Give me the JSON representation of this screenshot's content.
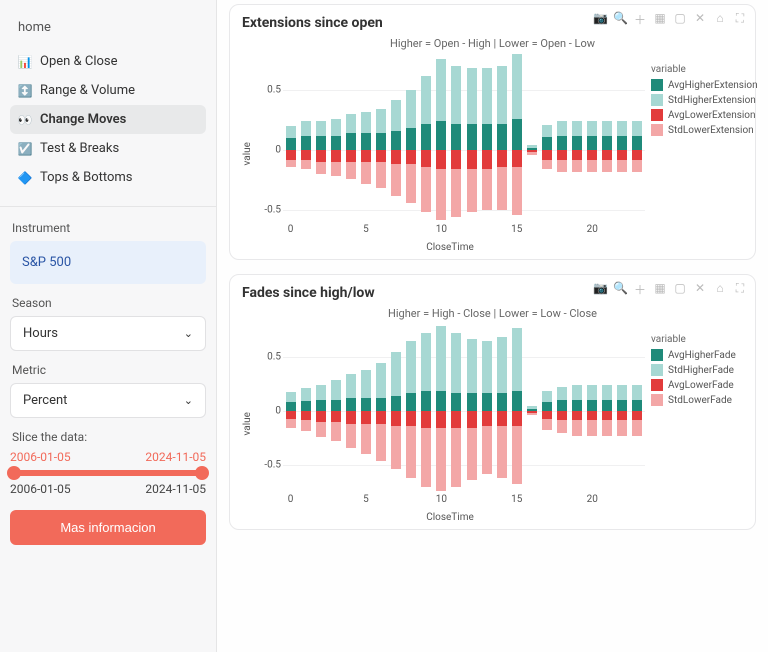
{
  "sidebar": {
    "home": "home",
    "items": [
      {
        "label": "Open & Close",
        "icon": "bars-icon"
      },
      {
        "label": "Range & Volume",
        "icon": "arrows-icon"
      },
      {
        "label": "Change Moves",
        "icon": "binoculars-icon"
      },
      {
        "label": "Test & Breaks",
        "icon": "check-icon"
      },
      {
        "label": "Tops & Bottoms",
        "icon": "stack-icon"
      }
    ],
    "instrument_label": "Instrument",
    "instrument_value": "S&P 500",
    "season_label": "Season",
    "season_value": "Hours",
    "metric_label": "Metric",
    "metric_value": "Percent",
    "slice_label": "Slice the data:",
    "slice_from": "2006-01-05",
    "slice_to": "2024-11-05",
    "info_button": "Mas informacion"
  },
  "colors": {
    "teal_dark": "#1f8a7a",
    "teal_light": "#a7d8d3",
    "red_dark": "#e23b3b",
    "red_light": "#f3a7a7"
  },
  "chart_data": [
    {
      "type": "bar",
      "title": "Extensions since open",
      "subtitle": "Higher = Open - High  | Lower = Open - Low",
      "xlabel": "CloseTime",
      "ylabel": "value",
      "ylim": [
        -0.6,
        0.8
      ],
      "yticks": [
        -0.5,
        0,
        0.5
      ],
      "xticks": [
        0,
        5,
        10,
        15,
        20
      ],
      "categories": [
        0,
        1,
        2,
        3,
        4,
        5,
        6,
        7,
        8,
        9,
        10,
        11,
        12,
        13,
        14,
        15,
        16,
        17,
        18,
        19,
        20,
        21,
        22,
        23
      ],
      "legend_title": "variable",
      "series": [
        {
          "name": "AvgHigherExtension",
          "color": "teal_dark",
          "values": [
            0.1,
            0.12,
            0.12,
            0.12,
            0.14,
            0.14,
            0.14,
            0.16,
            0.18,
            0.22,
            0.24,
            0.22,
            0.22,
            0.22,
            0.22,
            0.26,
            0.02,
            0.11,
            0.12,
            0.12,
            0.12,
            0.12,
            0.12,
            0.12
          ]
        },
        {
          "name": "StdHigherExtension",
          "color": "teal_light",
          "values": [
            0.1,
            0.12,
            0.12,
            0.14,
            0.16,
            0.18,
            0.2,
            0.26,
            0.32,
            0.4,
            0.52,
            0.48,
            0.46,
            0.46,
            0.48,
            0.54,
            0.02,
            0.1,
            0.12,
            0.12,
            0.12,
            0.12,
            0.12,
            0.12
          ]
        },
        {
          "name": "AvgLowerExtension",
          "color": "red_dark",
          "values": [
            -0.08,
            -0.08,
            -0.1,
            -0.1,
            -0.1,
            -0.1,
            -0.1,
            -0.12,
            -0.12,
            -0.14,
            -0.16,
            -0.16,
            -0.16,
            -0.16,
            -0.14,
            -0.14,
            -0.02,
            -0.08,
            -0.08,
            -0.08,
            -0.08,
            -0.08,
            -0.08,
            -0.08
          ]
        },
        {
          "name": "StdLowerExtension",
          "color": "red_light",
          "values": [
            -0.06,
            -0.08,
            -0.1,
            -0.12,
            -0.14,
            -0.18,
            -0.22,
            -0.26,
            -0.32,
            -0.38,
            -0.42,
            -0.4,
            -0.36,
            -0.34,
            -0.36,
            -0.4,
            -0.02,
            -0.08,
            -0.1,
            -0.1,
            -0.1,
            -0.1,
            -0.1,
            -0.1
          ]
        }
      ]
    },
    {
      "type": "bar",
      "title": "Fades since high/low",
      "subtitle": "Higher = High - Close  | Lower = Low - Close",
      "xlabel": "CloseTime",
      "ylabel": "value",
      "ylim": [
        -0.75,
        0.8
      ],
      "yticks": [
        -0.5,
        0,
        0.5
      ],
      "xticks": [
        0,
        5,
        10,
        15,
        20
      ],
      "categories": [
        0,
        1,
        2,
        3,
        4,
        5,
        6,
        7,
        8,
        9,
        10,
        11,
        12,
        13,
        14,
        15,
        16,
        17,
        18,
        19,
        20,
        21,
        22,
        23
      ],
      "legend_title": "variable",
      "series": [
        {
          "name": "AvgHigherFade",
          "color": "teal_dark",
          "values": [
            0.08,
            0.09,
            0.1,
            0.1,
            0.12,
            0.12,
            0.12,
            0.14,
            0.16,
            0.18,
            0.18,
            0.16,
            0.16,
            0.16,
            0.16,
            0.18,
            0.02,
            0.08,
            0.1,
            0.1,
            0.1,
            0.1,
            0.1,
            0.1
          ]
        },
        {
          "name": "StdHigherFade",
          "color": "teal_light",
          "values": [
            0.09,
            0.12,
            0.14,
            0.18,
            0.22,
            0.26,
            0.32,
            0.4,
            0.48,
            0.54,
            0.6,
            0.56,
            0.5,
            0.48,
            0.52,
            0.58,
            0.02,
            0.1,
            0.12,
            0.14,
            0.14,
            0.14,
            0.14,
            0.14
          ]
        },
        {
          "name": "AvgLowerFade",
          "color": "red_dark",
          "values": [
            -0.08,
            -0.09,
            -0.1,
            -0.1,
            -0.12,
            -0.12,
            -0.12,
            -0.14,
            -0.14,
            -0.16,
            -0.16,
            -0.16,
            -0.16,
            -0.14,
            -0.14,
            -0.14,
            -0.02,
            -0.08,
            -0.09,
            -0.09,
            -0.09,
            -0.09,
            -0.09,
            -0.09
          ]
        },
        {
          "name": "StdLowerFade",
          "color": "red_light",
          "values": [
            -0.08,
            -0.1,
            -0.14,
            -0.18,
            -0.22,
            -0.28,
            -0.34,
            -0.4,
            -0.48,
            -0.54,
            -0.58,
            -0.54,
            -0.48,
            -0.44,
            -0.48,
            -0.54,
            -0.02,
            -0.1,
            -0.12,
            -0.14,
            -0.14,
            -0.14,
            -0.14,
            -0.14
          ]
        }
      ]
    }
  ]
}
